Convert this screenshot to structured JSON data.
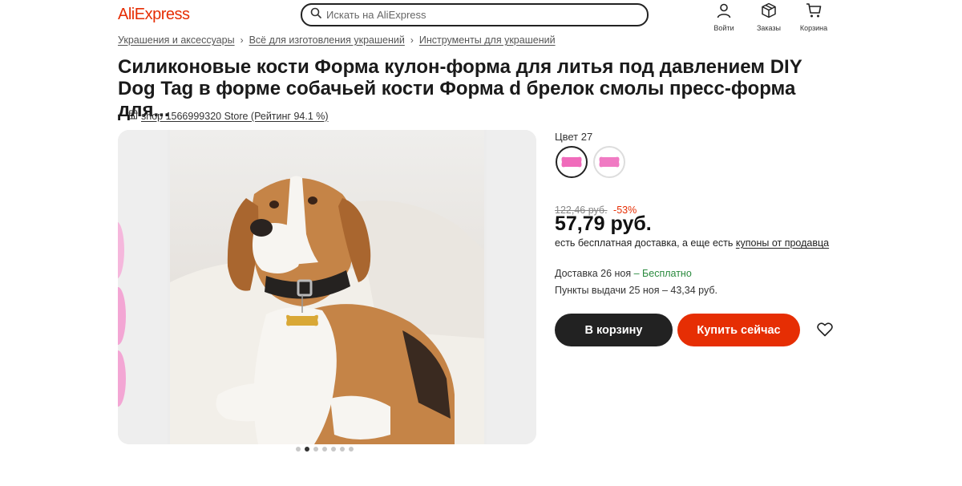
{
  "header": {
    "logo": "AliExpress",
    "search_placeholder": "Искать на AliExpress",
    "login_label": "Войти",
    "orders_label": "Заказы",
    "cart_label": "Корзина"
  },
  "breadcrumb": [
    "Украшения и аксессуары",
    "Всё для изготовления украшений",
    "Инструменты для украшений"
  ],
  "product": {
    "title": "Силиконовые кости Форма кулон-форма для литья под давлением DIY Dog Tag в форме собачьей кости Форма d брелок смолы пресс-форма для...",
    "store": "shop 1566999320 Store (Рейтинг 94.1 %)"
  },
  "gallery": {
    "dot_count": 7,
    "active_index": 1
  },
  "options": {
    "color_label": "Цвет 27",
    "swatch_color": "#f06bbb"
  },
  "pricing": {
    "old_price": "122,46 руб.",
    "discount": "-53%",
    "price": "57,79 руб.",
    "ship_note_prefix": "есть бесплатная доставка, а еще есть ",
    "ship_note_link": "купоны от продавца"
  },
  "delivery": {
    "line1_prefix": "Доставка 26 ноя",
    "line1_free": " – Бесплатно",
    "line2": "Пункты выдачи 25 ноя – 43,34 руб."
  },
  "actions": {
    "add_to_cart": "В корзину",
    "buy_now": "Купить сейчас"
  },
  "colors": {
    "brand": "#e62e04",
    "dark_button": "#222222",
    "free_green": "#2a8a3e"
  }
}
